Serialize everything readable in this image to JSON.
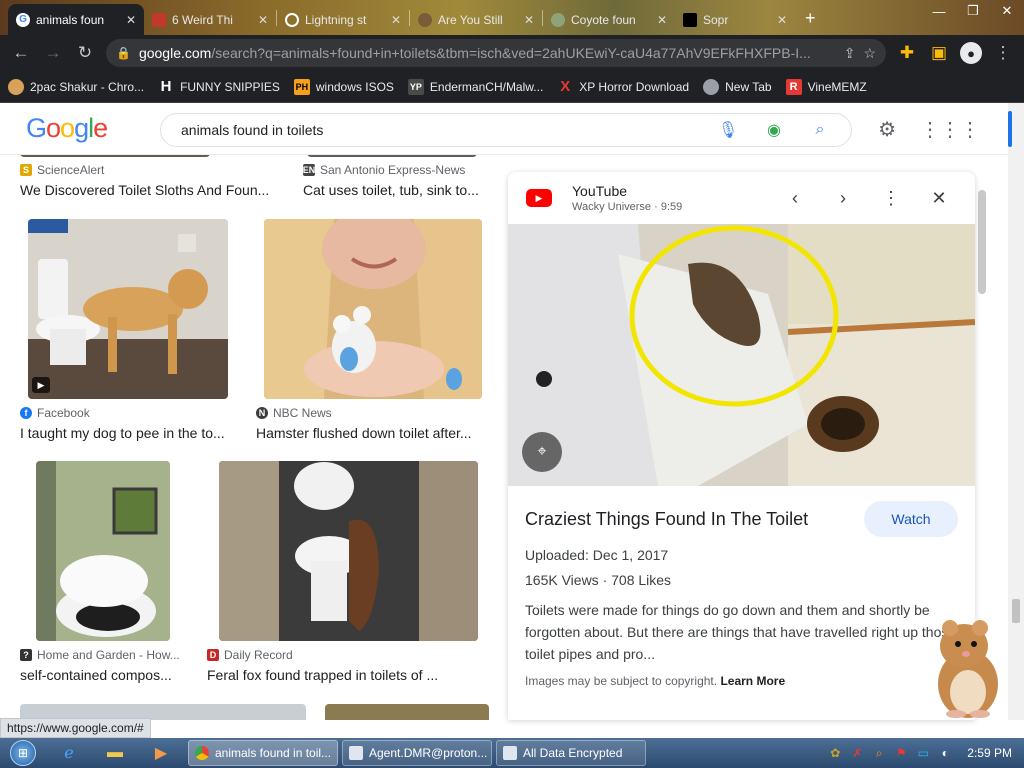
{
  "tabs": [
    {
      "title": "animals foun",
      "active": true
    },
    {
      "title": "6 Weird Thi",
      "active": false
    },
    {
      "title": "Lightning st",
      "active": false
    },
    {
      "title": "Are You Still",
      "active": false
    },
    {
      "title": "Coyote foun",
      "active": false
    },
    {
      "title": "Sopr",
      "active": false
    }
  ],
  "toolbar": {
    "url_host": "google.com",
    "url_rest": "/search?q=animals+found+in+toilets&tbm=isch&ved=2ahUKEwiY-caU4a77AhV9EFkFHXFPB-I..."
  },
  "bookmarks": [
    {
      "label": "2pac Shakur - Chro...",
      "icon": "cookie-icon",
      "color": "#d9a15a"
    },
    {
      "label": "FUNNY SNIPPIES",
      "icon": "H",
      "color": "#ffffff"
    },
    {
      "label": "windows ISOS",
      "icon": "PH",
      "color": "#f7a01b"
    },
    {
      "label": "EndermanCH/Malw...",
      "icon": "YP",
      "color": "#4a4a4a"
    },
    {
      "label": "XP Horror Download",
      "icon": "X",
      "color": "#e53935"
    },
    {
      "label": "New Tab",
      "icon": "globe-icon",
      "color": "#9aa0a6"
    },
    {
      "label": "VineMEMZ",
      "icon": "R",
      "color": "#e53935"
    }
  ],
  "search": {
    "query": "animals found in toilets"
  },
  "results": [
    {
      "source": "ScienceAlert",
      "title": "We Discovered Toilet Sloths And Foun..."
    },
    {
      "source": "San Antonio Express-News",
      "title": "Cat uses toilet, tub, sink to..."
    },
    {
      "source": "Facebook",
      "title": "I taught my dog to pee in the to..."
    },
    {
      "source": "NBC News",
      "title": "Hamster flushed down toilet after..."
    },
    {
      "source": "Home and Garden - How...",
      "title": "self-contained compos..."
    },
    {
      "source": "Daily Record",
      "title": "Feral fox found trapped in toilets of ..."
    }
  ],
  "panel": {
    "site": "YouTube",
    "sub": "Wacky Universe · 9:59",
    "title": "Craziest Things Found In The Toilet",
    "watch": "Watch",
    "uploaded": "Uploaded: Dec 1, 2017",
    "stats": "165K Views · 708 Likes",
    "description": "Toilets were made for things do go down and them and shortly be forgotten about. But there are things that have travelled right up those toilet pipes and pro...",
    "copyright": "Images may be subject to copyright.",
    "learn_more": "Learn More"
  },
  "status_url": "https://www.google.com/#",
  "taskbar": {
    "tasks": [
      {
        "label": "animals found in toil...",
        "active": true
      },
      {
        "label": "Agent.DMR@proton...",
        "active": false
      },
      {
        "label": "All Data Encrypted",
        "active": false
      }
    ],
    "clock": "2:59 PM"
  }
}
